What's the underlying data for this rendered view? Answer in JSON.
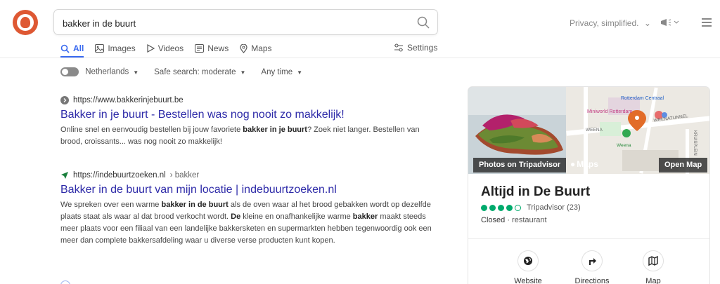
{
  "search": {
    "query": "bakker in de buurt"
  },
  "header": {
    "privacy_label": "Privacy, simplified."
  },
  "tabs": [
    {
      "label": "All"
    },
    {
      "label": "Images"
    },
    {
      "label": "Videos"
    },
    {
      "label": "News"
    },
    {
      "label": "Maps"
    }
  ],
  "settings_label": "Settings",
  "filters": {
    "region": "Netherlands",
    "safe_search": "Safe search: moderate",
    "time": "Any time"
  },
  "results": [
    {
      "url": "https://www.bakkerinjebuurt.be",
      "crumb": "",
      "title": "Bakker in je buurt - Bestellen was nog nooit zo makkelijk!",
      "snippet_parts": [
        "Online snel en eenvoudig bestellen bij jouw favoriete ",
        "bakker in je buurt",
        "? Zoek niet langer. Bestellen van brood, croissants... was nog nooit zo makkelijk!"
      ]
    },
    {
      "url": "https://indebuurtzoeken.nl",
      "crumb": "› bakker",
      "title": "Bakker in de buurt van mijn locatie | indebuurtzoeken.nl",
      "snippet_parts": [
        "We spreken over een warme ",
        "bakker in de buurt",
        " als de oven waar al het brood gebakken wordt op dezelfde plaats staat als waar al dat brood verkocht wordt. ",
        "De",
        " kleine en onafhankelijke warme ",
        "bakker",
        " maakt steeds meer plaats voor een filiaal van een landelijke bakkersketen en supermarkten hebben tegenwoordig ook een meer dan complete bakkersafdeling waar u diverse verse producten kunt kopen."
      ]
    }
  ],
  "panel": {
    "photos_label": "Photos on Tripadvisor",
    "maps_label": "Maps",
    "open_map_label": "Open Map",
    "map_labels": [
      "Rotterdam Centraal",
      "Miniworld Rotterdam",
      "WEENATUNNEL",
      "WEENA",
      "Weena",
      "KRUISPLEIN"
    ],
    "name": "Altijd in De Buurt",
    "rating": {
      "filled": 4,
      "total": 5,
      "source": "Tripadvisor (23)"
    },
    "status": "Closed",
    "category": "· restaurant",
    "actions": [
      {
        "label": "Website"
      },
      {
        "label": "Directions"
      },
      {
        "label": "Map"
      }
    ]
  }
}
